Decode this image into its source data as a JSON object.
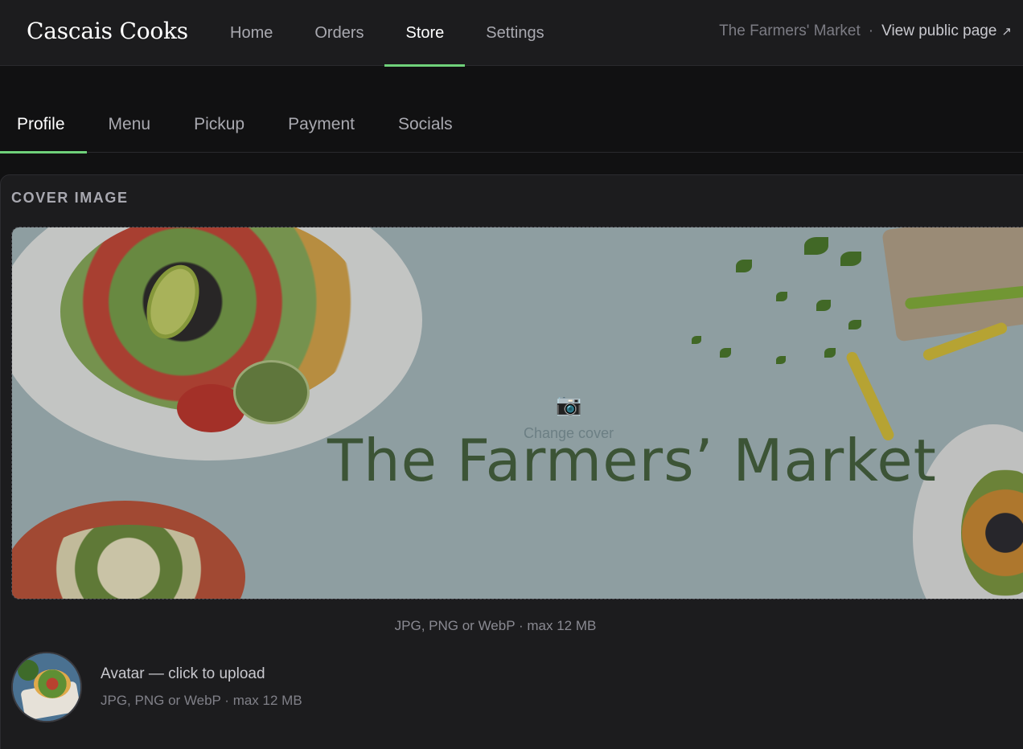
{
  "app": {
    "brand": "Cascais Cooks"
  },
  "topnav": {
    "items": [
      {
        "label": "Home",
        "active": false
      },
      {
        "label": "Orders",
        "active": false
      },
      {
        "label": "Store",
        "active": true
      },
      {
        "label": "Settings",
        "active": false
      }
    ],
    "store_name": "The Farmers' Market",
    "separator": "·",
    "view_public_label": "View public page",
    "view_public_icon": "external-link-icon",
    "external_glyph": "↗"
  },
  "subtabs": {
    "items": [
      {
        "label": "Profile",
        "active": true
      },
      {
        "label": "Menu",
        "active": false
      },
      {
        "label": "Pickup",
        "active": false
      },
      {
        "label": "Payment",
        "active": false
      },
      {
        "label": "Socials",
        "active": false
      }
    ]
  },
  "cover": {
    "section_title": "COVER IMAGE",
    "camera_glyph": "📷",
    "change_label": "Change cover",
    "wordmark": "The Farmers’ Market",
    "hint": "JPG, PNG or WebP · max 12 MB"
  },
  "avatar": {
    "title": "Avatar — click to upload",
    "hint": "JPG, PNG or WebP · max 12 MB"
  },
  "colors": {
    "accent": "#6fd17a",
    "background": "#111112",
    "surface": "#1c1c1e"
  }
}
